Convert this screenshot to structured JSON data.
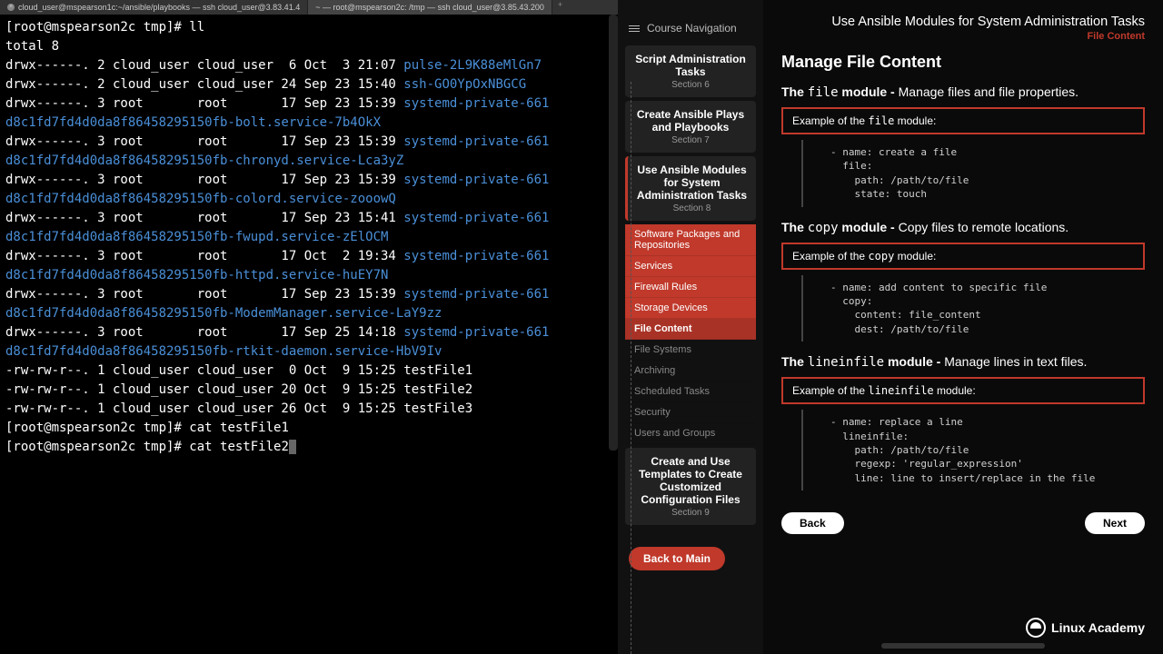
{
  "tabs": [
    {
      "label": "cloud_user@mspearson1c:~/ansible/playbooks — ssh cloud_user@3.83.41.4"
    },
    {
      "label": "~ — root@mspearson2c: /tmp — ssh cloud_user@3.85.43.200"
    }
  ],
  "terminal": {
    "prompt1": "[root@mspearson2c tmp]# ",
    "cmd1": "ll",
    "lines": [
      {
        "pre": "total 8",
        "link": ""
      },
      {
        "pre": "drwx------. 2 cloud_user cloud_user  6 Oct  3 21:07 ",
        "link": "pulse-2L9K88eMlGn7"
      },
      {
        "pre": "drwx------. 2 cloud_user cloud_user 24 Sep 23 15:40 ",
        "link": "ssh-GO0YpOxNBGCG"
      },
      {
        "pre": "drwx------. 3 root       root       17 Sep 23 15:39 ",
        "link": "systemd-private-661"
      },
      {
        "pre": "",
        "link": "d8c1fd7fd4d0da8f86458295150fb-bolt.service-7b4OkX"
      },
      {
        "pre": "drwx------. 3 root       root       17 Sep 23 15:39 ",
        "link": "systemd-private-661"
      },
      {
        "pre": "",
        "link": "d8c1fd7fd4d0da8f86458295150fb-chronyd.service-Lca3yZ"
      },
      {
        "pre": "drwx------. 3 root       root       17 Sep 23 15:39 ",
        "link": "systemd-private-661"
      },
      {
        "pre": "",
        "link": "d8c1fd7fd4d0da8f86458295150fb-colord.service-zooowQ"
      },
      {
        "pre": "drwx------. 3 root       root       17 Sep 23 15:41 ",
        "link": "systemd-private-661"
      },
      {
        "pre": "",
        "link": "d8c1fd7fd4d0da8f86458295150fb-fwupd.service-zElOCM"
      },
      {
        "pre": "drwx------. 3 root       root       17 Oct  2 19:34 ",
        "link": "systemd-private-661"
      },
      {
        "pre": "",
        "link": "d8c1fd7fd4d0da8f86458295150fb-httpd.service-huEY7N"
      },
      {
        "pre": "drwx------. 3 root       root       17 Sep 23 15:39 ",
        "link": "systemd-private-661"
      },
      {
        "pre": "",
        "link": "d8c1fd7fd4d0da8f86458295150fb-ModemManager.service-LaY9zz"
      },
      {
        "pre": "drwx------. 3 root       root       17 Sep 25 14:18 ",
        "link": "systemd-private-661"
      },
      {
        "pre": "",
        "link": "d8c1fd7fd4d0da8f86458295150fb-rtkit-daemon.service-HbV9Iv"
      },
      {
        "pre": "-rw-rw-r--. 1 cloud_user cloud_user  0 Oct  9 15:25 testFile1",
        "link": ""
      },
      {
        "pre": "-rw-rw-r--. 1 cloud_user cloud_user 20 Oct  9 15:25 testFile2",
        "link": ""
      },
      {
        "pre": "-rw-rw-r--. 1 cloud_user cloud_user 26 Oct  9 15:25 testFile3",
        "link": ""
      }
    ],
    "prompt2": "[root@mspearson2c tmp]# ",
    "cmd2": "cat testFile1",
    "prompt3": "[root@mspearson2c tmp]# ",
    "cmd3": "cat testFile2"
  },
  "nav": {
    "header": "Course Navigation",
    "sections": [
      {
        "title": "Script Administration Tasks",
        "sub": "Section 6"
      },
      {
        "title": "Create Ansible Plays and Playbooks",
        "sub": "Section 7"
      },
      {
        "title": "Use Ansible Modules for System Administration Tasks",
        "sub": "Section 8"
      },
      {
        "title": "Create and Use Templates to Create Customized Configuration Files",
        "sub": "Section 9"
      }
    ],
    "subitems_red": [
      "Software Packages and Repositories",
      "Services",
      "Firewall Rules",
      "Storage Devices",
      "File Content"
    ],
    "subitems_gray": [
      "File Systems",
      "Archiving",
      "Scheduled Tasks",
      "Security",
      "Users and Groups"
    ],
    "back": "Back to Main"
  },
  "content": {
    "page_title": "Use Ansible Modules for System Administration Tasks",
    "page_sub": "File Content",
    "h2": "Manage File Content",
    "modules": [
      {
        "desc_pre": "The ",
        "mod": "file",
        "desc_post": " module - ",
        "tail": "Manage files and file properties.",
        "example_pre": "Example of the ",
        "example_mod": "file",
        "example_post": " module:",
        "code": "- name: create a file\n  file:\n    path: /path/to/file\n    state: touch"
      },
      {
        "desc_pre": "The ",
        "mod": "copy",
        "desc_post": " module - ",
        "tail": "Copy files to remote locations.",
        "example_pre": "Example of the ",
        "example_mod": "copy",
        "example_post": " module:",
        "code": "- name: add content to specific file\n  copy:\n    content: file_content\n    dest: /path/to/file"
      },
      {
        "desc_pre": "The ",
        "mod": "lineinfile",
        "desc_post": " module - ",
        "tail": "Manage lines in text files.",
        "example_pre": "Example of the ",
        "example_mod": "lineinfile",
        "example_post": " module:",
        "code": "- name: replace a line\n  lineinfile:\n    path: /path/to/file\n    regexp: 'regular_expression'\n    line: line to insert/replace in the file"
      }
    ],
    "back_btn": "Back",
    "next_btn": "Next",
    "brand": "Linux Academy"
  }
}
